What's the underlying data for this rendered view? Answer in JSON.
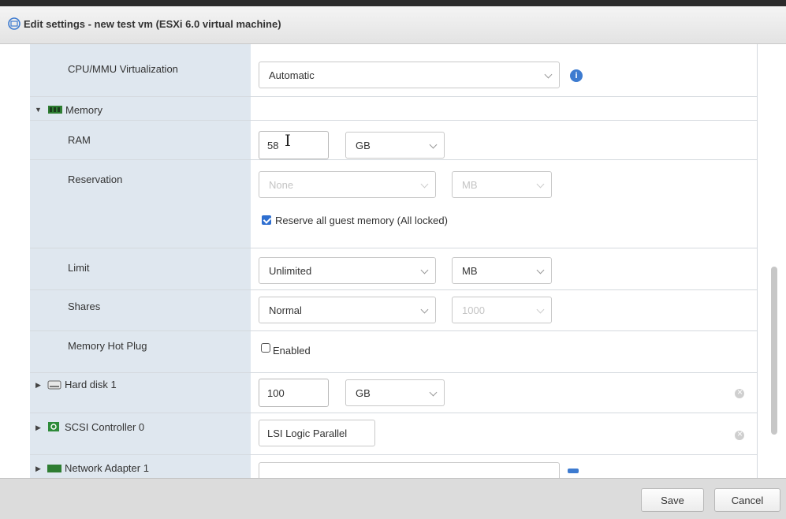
{
  "dialog": {
    "title": "Edit settings - new test vm (ESXi 6.0 virtual machine)",
    "save_label": "Save",
    "cancel_label": "Cancel"
  },
  "cpu": {
    "mmu_label": "CPU/MMU Virtualization",
    "mmu_value": "Automatic"
  },
  "memory": {
    "section_label": "Memory",
    "ram_label": "RAM",
    "ram_value": "58",
    "ram_unit": "GB",
    "reservation_label": "Reservation",
    "reservation_value": "None",
    "reservation_unit": "MB",
    "reserve_all_label": "Reserve all guest memory (All locked)",
    "reserve_all_checked": true,
    "limit_label": "Limit",
    "limit_value": "Unlimited",
    "limit_unit": "MB",
    "shares_label": "Shares",
    "shares_value": "Normal",
    "shares_number": "1000",
    "hotplug_label": "Memory Hot Plug",
    "hotplug_enabled_label": "Enabled",
    "hotplug_checked": false
  },
  "hard_disk": {
    "label": "Hard disk 1",
    "size": "100",
    "unit": "GB"
  },
  "scsi": {
    "label": "SCSI Controller 0",
    "value": "LSI Logic Parallel"
  },
  "network": {
    "label": "Network Adapter 1"
  },
  "colors": {
    "label_column": "#dfe7ef",
    "accent": "#2f6fd0",
    "footer": "#dcdcdc"
  }
}
